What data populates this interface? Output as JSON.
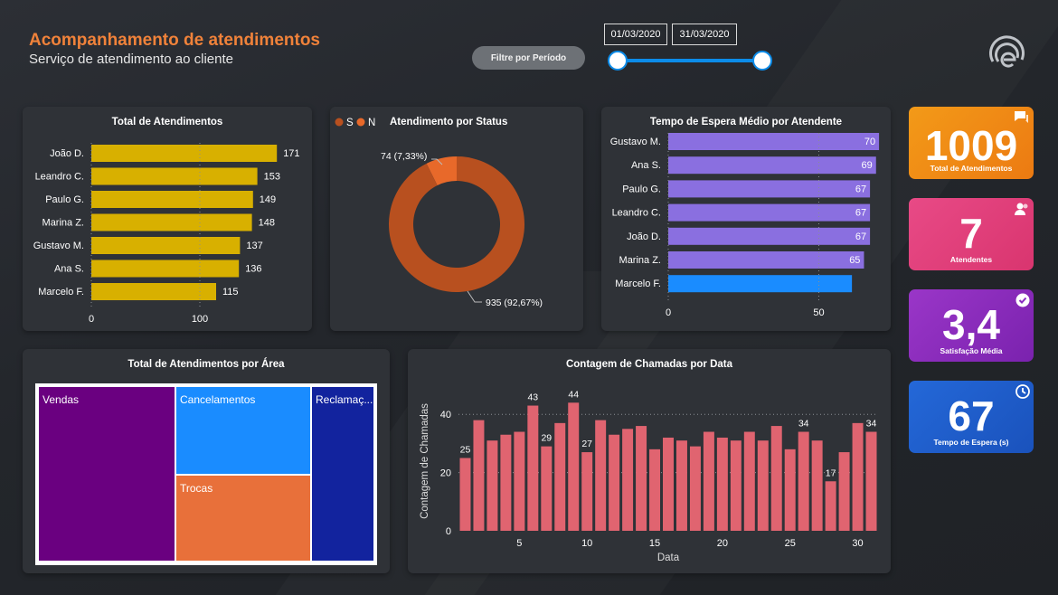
{
  "header": {
    "title": "Acompanhamento de atendimentos",
    "subtitle": "Serviço de atendimento ao cliente",
    "filter_label": "Filtre por Período",
    "date_start": "01/03/2020",
    "date_end": "31/03/2020"
  },
  "colors": {
    "title_orange": "#f0823a",
    "bar_yellow": "#d8b000",
    "donut_dark": "#b8501f",
    "donut_light": "#e8692a",
    "bar_purple": "#8a6fe0",
    "bar_blue": "#1a8cff",
    "bar_red": "#e06470",
    "kpi_orange": "#f08a10",
    "kpi_pink": "#e0407a",
    "kpi_purple": "#8a2bc0",
    "kpi_blue": "#1f5fd0"
  },
  "atendimentos": {
    "title": "Total de Atendimentos",
    "names": [
      "João D.",
      "Leandro C.",
      "Paulo G.",
      "Marina Z.",
      "Gustavo M.",
      "Ana S.",
      "Marcelo F."
    ],
    "values": [
      171,
      153,
      149,
      148,
      137,
      136,
      115
    ],
    "ticks": [
      "0",
      "100"
    ]
  },
  "status": {
    "title": "Atendimento por Status",
    "legend": [
      "S",
      "N"
    ],
    "small_value": 74,
    "big_value": 935,
    "small_label": "74 (7,33%)",
    "big_label": "935 (92,67%)"
  },
  "espera": {
    "title": "Tempo de Espera Médio por Atendente",
    "names": [
      "Gustavo M.",
      "Ana S.",
      "Paulo G.",
      "Leandro C.",
      "João D.",
      "Marina Z.",
      "Marcelo F."
    ],
    "values": [
      70,
      69,
      67,
      67,
      67,
      65,
      61
    ],
    "labels": [
      "70",
      "69",
      "67",
      "67",
      "67",
      "65",
      ""
    ],
    "ticks": [
      "0",
      "50"
    ],
    "reference": 65
  },
  "kpis": [
    {
      "value": "1009",
      "label": "Total de Atendimentos",
      "icon": "chat-icon"
    },
    {
      "value": "7",
      "label": "Atendentes",
      "icon": "users-icon"
    },
    {
      "value": "3,4",
      "label": "Satisfação Média",
      "icon": "check-icon"
    },
    {
      "value": "67",
      "label": "Tempo de Espera (s)",
      "icon": "clock-icon"
    }
  ],
  "area": {
    "title": "Total de Atendimentos por Área",
    "items": [
      {
        "name": "Vendas",
        "color": "#6a0080"
      },
      {
        "name": "Cancelamentos",
        "color": "#1a8cff"
      },
      {
        "name": "Trocas",
        "color": "#e8703a"
      },
      {
        "name": "Reclamaç...",
        "color": "#12239e"
      }
    ]
  },
  "chamadas": {
    "title": "Contagem de Chamadas por Data",
    "xlabel": "Data",
    "ylabel": "Contagem de Chamadas",
    "x": [
      1,
      2,
      3,
      4,
      5,
      6,
      7,
      8,
      9,
      10,
      11,
      12,
      13,
      14,
      15,
      16,
      17,
      18,
      19,
      20,
      21,
      22,
      23,
      24,
      25,
      26,
      27,
      28,
      29,
      30,
      31
    ],
    "values": [
      25,
      38,
      31,
      33,
      34,
      43,
      29,
      37,
      44,
      27,
      38,
      33,
      35,
      36,
      28,
      32,
      31,
      29,
      34,
      32,
      31,
      34,
      31,
      36,
      28,
      34,
      31,
      17,
      27,
      37,
      34
    ],
    "y_ticks": [
      0,
      20,
      40
    ],
    "x_ticks": [
      5,
      10,
      15,
      20,
      25,
      30
    ],
    "labeled": [
      1,
      6,
      7,
      9,
      10,
      26,
      28,
      31
    ]
  }
}
